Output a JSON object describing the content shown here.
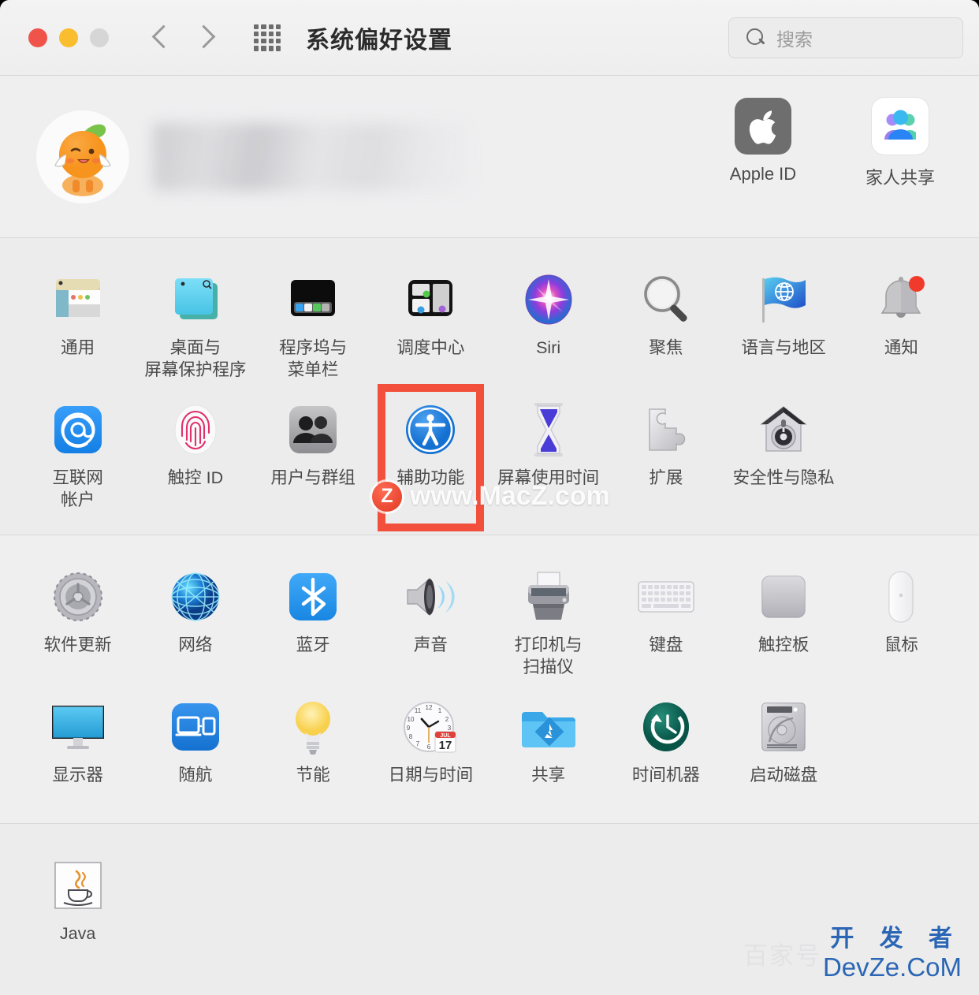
{
  "window": {
    "title": "系统偏好设置",
    "traffic_lights": [
      "close-red",
      "minimize-yellow",
      "zoom-gray"
    ],
    "nav_back": "back-chevron",
    "nav_forward": "forward-chevron",
    "grid_button": "show-all-grid"
  },
  "search": {
    "placeholder": "搜索",
    "icon": "search-icon"
  },
  "account": {
    "avatar_alt": "orange-cartoon-avatar",
    "name_redacted": "",
    "items": [
      {
        "label": "Apple ID",
        "icon": "apple-logo-icon"
      },
      {
        "label": "家人共享",
        "icon": "family-sharing-icon"
      }
    ]
  },
  "sections": [
    {
      "name": "personal",
      "rows": [
        [
          {
            "label": "通用",
            "icon": "general-icon"
          },
          {
            "label": "桌面与\n屏幕保护程序",
            "icon": "desktop-screensaver-icon"
          },
          {
            "label": "程序坞与\n菜单栏",
            "icon": "dock-menubar-icon"
          },
          {
            "label": "调度中心",
            "icon": "mission-control-icon"
          },
          {
            "label": "Siri",
            "icon": "siri-icon"
          },
          {
            "label": "聚焦",
            "icon": "spotlight-icon"
          },
          {
            "label": "语言与地区",
            "icon": "language-region-icon"
          },
          {
            "label": "通知",
            "icon": "notifications-icon"
          }
        ],
        [
          {
            "label": "互联网\n帐户",
            "icon": "internet-accounts-icon"
          },
          {
            "label": "触控 ID",
            "icon": "touch-id-icon"
          },
          {
            "label": "用户与群组",
            "icon": "users-groups-icon"
          },
          {
            "label": "辅助功能",
            "icon": "accessibility-icon",
            "highlighted": true
          },
          {
            "label": "屏幕使用时间",
            "icon": "screen-time-icon"
          },
          {
            "label": "扩展",
            "icon": "extensions-icon"
          },
          {
            "label": "安全性与隐私",
            "icon": "security-privacy-icon"
          }
        ]
      ]
    },
    {
      "name": "hardware",
      "rows": [
        [
          {
            "label": "软件更新",
            "icon": "software-update-icon"
          },
          {
            "label": "网络",
            "icon": "network-icon"
          },
          {
            "label": "蓝牙",
            "icon": "bluetooth-icon"
          },
          {
            "label": "声音",
            "icon": "sound-icon"
          },
          {
            "label": "打印机与\n扫描仪",
            "icon": "printers-scanners-icon"
          },
          {
            "label": "键盘",
            "icon": "keyboard-icon"
          },
          {
            "label": "触控板",
            "icon": "trackpad-icon"
          },
          {
            "label": "鼠标",
            "icon": "mouse-icon"
          }
        ],
        [
          {
            "label": "显示器",
            "icon": "displays-icon"
          },
          {
            "label": "随航",
            "icon": "sidecar-icon"
          },
          {
            "label": "节能",
            "icon": "energy-saver-icon"
          },
          {
            "label": "日期与时间",
            "icon": "date-time-icon"
          },
          {
            "label": "共享",
            "icon": "sharing-icon"
          },
          {
            "label": "时间机器",
            "icon": "time-machine-icon"
          },
          {
            "label": "启动磁盘",
            "icon": "startup-disk-icon"
          }
        ]
      ]
    },
    {
      "name": "other",
      "rows": [
        [
          {
            "label": "Java",
            "icon": "java-icon"
          }
        ]
      ]
    }
  ],
  "date_icon": {
    "month": "JUL",
    "day": "17"
  },
  "watermarks": {
    "macz": "www.MacZ.com",
    "macz_logo": "Z",
    "baijiahao": "百家号",
    "kaifazhe": "开 发 者",
    "devze": "DevZe.CoM"
  },
  "colors": {
    "accent_red": "#f2503c",
    "window_bg": "#ececec",
    "titlebar_bg": "#f1f1f1",
    "label_text": "#4a4a4a",
    "apple_tile": "#6e6e6e",
    "blue": "#1b8cf5"
  }
}
